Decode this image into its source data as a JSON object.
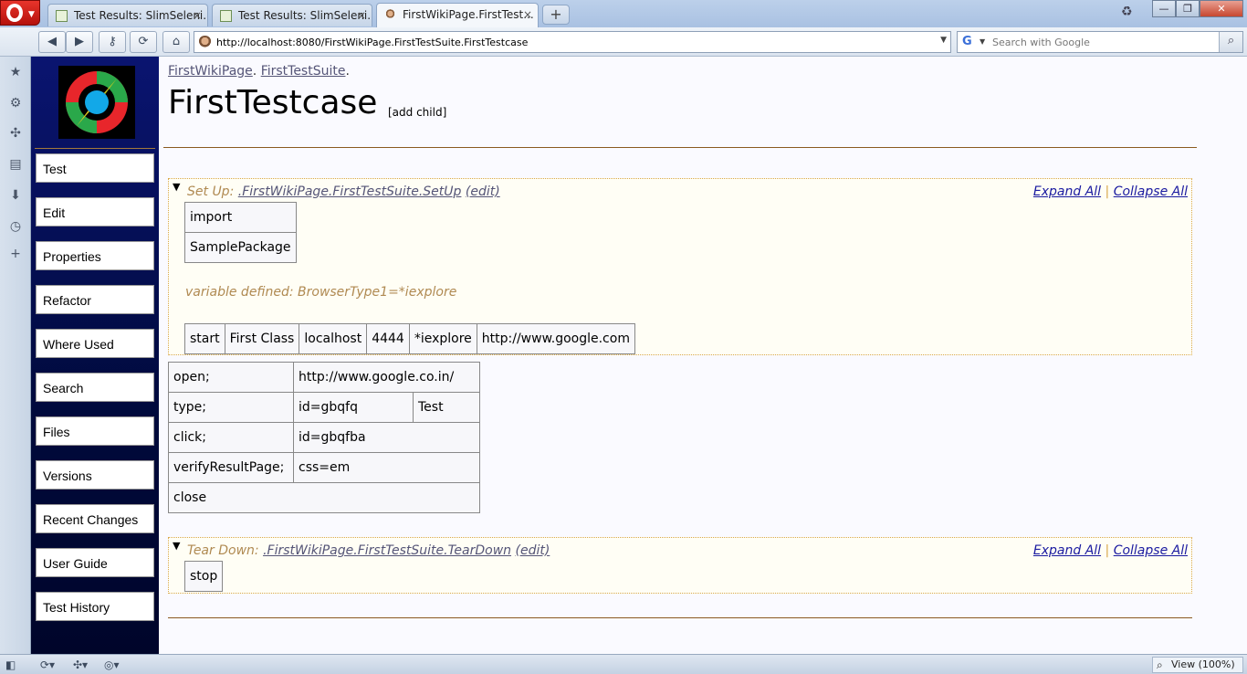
{
  "browser": {
    "tabs": [
      {
        "title": "Test Results: SlimSeleni...",
        "close": "×"
      },
      {
        "title": "Test Results: SlimSeleni...",
        "close": "×"
      },
      {
        "title": "FirstWikiPage.FirstTest...",
        "close": "×"
      }
    ],
    "new_tab": "+",
    "window_buttons": {
      "minimize": "—",
      "maximize": "❐",
      "close": "✕"
    },
    "nav": {
      "back": "◀",
      "forward": "▶",
      "key": "⚷",
      "reload": "⟳",
      "home": "⌂"
    },
    "address": "http://localhost:8080/FirstWikiPage.FirstTestSuite.FirstTestcase",
    "search_placeholder": "Search with Google",
    "search_engine": "G",
    "status": {
      "zoom": "View (100%)"
    }
  },
  "sidebar": {
    "items": [
      {
        "label": "Test"
      },
      {
        "label": "Edit"
      },
      {
        "label": "Properties"
      },
      {
        "label": "Refactor"
      },
      {
        "label": "Where Used"
      },
      {
        "label": "Search"
      },
      {
        "label": "Files"
      },
      {
        "label": "Versions"
      },
      {
        "label": "Recent Changes"
      },
      {
        "label": "User Guide"
      },
      {
        "label": "Test History"
      }
    ]
  },
  "page": {
    "breadcrumbs": [
      "FirstWikiPage",
      "FirstTestSuite"
    ],
    "title": "FirstTestcase",
    "add_child": "[add child]"
  },
  "setup": {
    "label": "Set Up:",
    "link": ".FirstWikiPage.FirstTestSuite.SetUp",
    "edit": "(edit)",
    "expand_all": "Expand All",
    "collapse_all": "Collapse All",
    "separator": "|",
    "import_table": [
      "import",
      "SamplePackage"
    ],
    "variable": "variable defined: BrowserType1=*iexplore",
    "start_row": [
      "start",
      "First Class",
      "localhost",
      "4444",
      "*iexplore",
      "http://www.google.com"
    ]
  },
  "script_table": [
    [
      "open;",
      "http://www.google.co.in/"
    ],
    [
      "type;",
      "id=gbqfq",
      "Test"
    ],
    [
      "click;",
      "id=gbqfba"
    ],
    [
      "verifyResultPage;",
      "css=em"
    ],
    [
      "close"
    ]
  ],
  "teardown": {
    "label": "Tear Down:",
    "link": ".FirstWikiPage.FirstTestSuite.TearDown",
    "edit": "(edit)",
    "expand_all": "Expand All",
    "collapse_all": "Collapse All",
    "separator": "|",
    "table": [
      "stop"
    ]
  },
  "colors": {
    "sidebar": "#0a1470",
    "rule": "#8a5a20",
    "collapsible_border": "#d9a84a"
  }
}
